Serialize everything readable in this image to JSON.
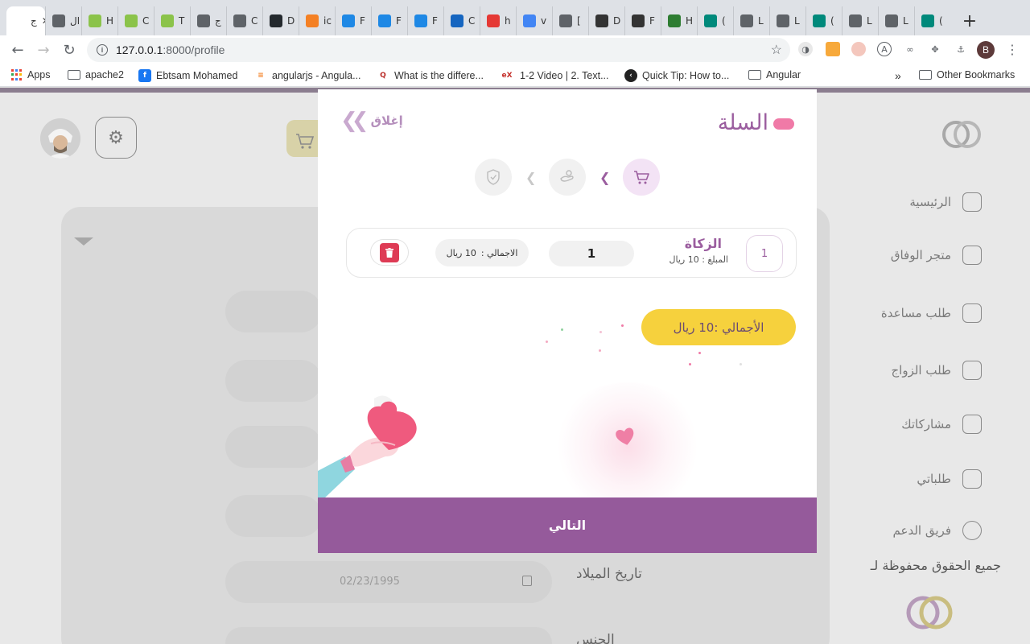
{
  "browser": {
    "tabs": [
      {
        "title": "ج",
        "color": "#ffffff",
        "icon": "page-icon"
      },
      {
        "title": "ال",
        "color": "#5f6368",
        "icon": "globe-icon"
      },
      {
        "title": "H",
        "color": "#8bc34a",
        "icon": "w3-icon"
      },
      {
        "title": "C",
        "color": "#8bc34a",
        "icon": "w3-icon"
      },
      {
        "title": "T",
        "color": "#8bc34a",
        "icon": "w3-icon"
      },
      {
        "title": "ج",
        "color": "#5f6368",
        "icon": "globe-icon"
      },
      {
        "title": "C",
        "color": "#5f6368",
        "icon": "book-icon"
      },
      {
        "title": "D",
        "color": "#24292e",
        "icon": "github-icon"
      },
      {
        "title": "ic",
        "color": "#f48024",
        "icon": "stackoverflow-icon"
      },
      {
        "title": "F",
        "color": "#1e88e5",
        "icon": "fv-icon"
      },
      {
        "title": "F",
        "color": "#1e88e5",
        "icon": "fv-icon"
      },
      {
        "title": "F",
        "color": "#1e88e5",
        "icon": "fv-icon"
      },
      {
        "title": "C",
        "color": "#1565c0",
        "icon": "infinity-icon"
      },
      {
        "title": "h",
        "color": "#e53935",
        "icon": "star-icon"
      },
      {
        "title": "v",
        "color": "#4285f4",
        "icon": "google-icon"
      },
      {
        "title": "[",
        "color": "#5f6368",
        "icon": "doc-icon"
      },
      {
        "title": "D",
        "color": "#333333",
        "icon": "arrow-icon"
      },
      {
        "title": "F",
        "color": "#333333",
        "icon": "linux-icon"
      },
      {
        "title": "H",
        "color": "#2e7d32",
        "icon": "link-icon"
      },
      {
        "title": "(",
        "color": "#00897b",
        "icon": "m-icon"
      },
      {
        "title": "L",
        "color": "#5f6368",
        "icon": "globe-icon"
      },
      {
        "title": "L",
        "color": "#5f6368",
        "icon": "globe-icon"
      },
      {
        "title": "(",
        "color": "#00897b",
        "icon": "m-icon"
      },
      {
        "title": "L",
        "color": "#5f6368",
        "icon": "globe-icon"
      },
      {
        "title": "L",
        "color": "#5f6368",
        "icon": "globe-icon"
      },
      {
        "title": "(",
        "color": "#00897b",
        "icon": "m-icon"
      }
    ],
    "url_host": "127.0.0.1",
    "url_path": ":8000/profile",
    "profile_initial": "B",
    "bookmarks": {
      "apps": "Apps",
      "apache": "apache2",
      "ebtsam": "Ebtsam Mohamed",
      "angularjs": "angularjs - Angula...",
      "quora": "What is the differe...",
      "edx": "1-2 Video | 2. Text...",
      "quicktip": "Quick Tip: How to...",
      "angular": "Angular",
      "more": "»",
      "other": "Other Bookmarks"
    }
  },
  "page": {
    "sidebar": [
      {
        "label": "الرئيسية"
      },
      {
        "label": "متجر الوفاق"
      },
      {
        "label": "طلب مساعدة"
      },
      {
        "label": "طلب الزواج"
      },
      {
        "label": "مشاركاتك"
      },
      {
        "label": "طلباتي"
      },
      {
        "label": "فريق الدعم"
      }
    ],
    "rights": "جميع الحقوق محفوظة لـ",
    "birth_label": "تاريخ الميلاد",
    "birth_value": "02/23/1995",
    "gender_label": "الجنس"
  },
  "modal": {
    "title": "السلة",
    "close_label": "إغلاق",
    "item": {
      "index": "1",
      "name": "الزكاة",
      "price": "المبلغ : 10 ريال",
      "quantity": "1",
      "total_label": "الاجمالي :",
      "total_value": "10 ريال"
    },
    "grand_total": "الأجمالي :10 ريال",
    "next_label": "التالي"
  },
  "colors": {
    "accent": "#955a9b",
    "title": "#9b5e9f",
    "pink": "#f07aa7",
    "yellow": "#f6d13d",
    "delete": "#de3b55"
  }
}
